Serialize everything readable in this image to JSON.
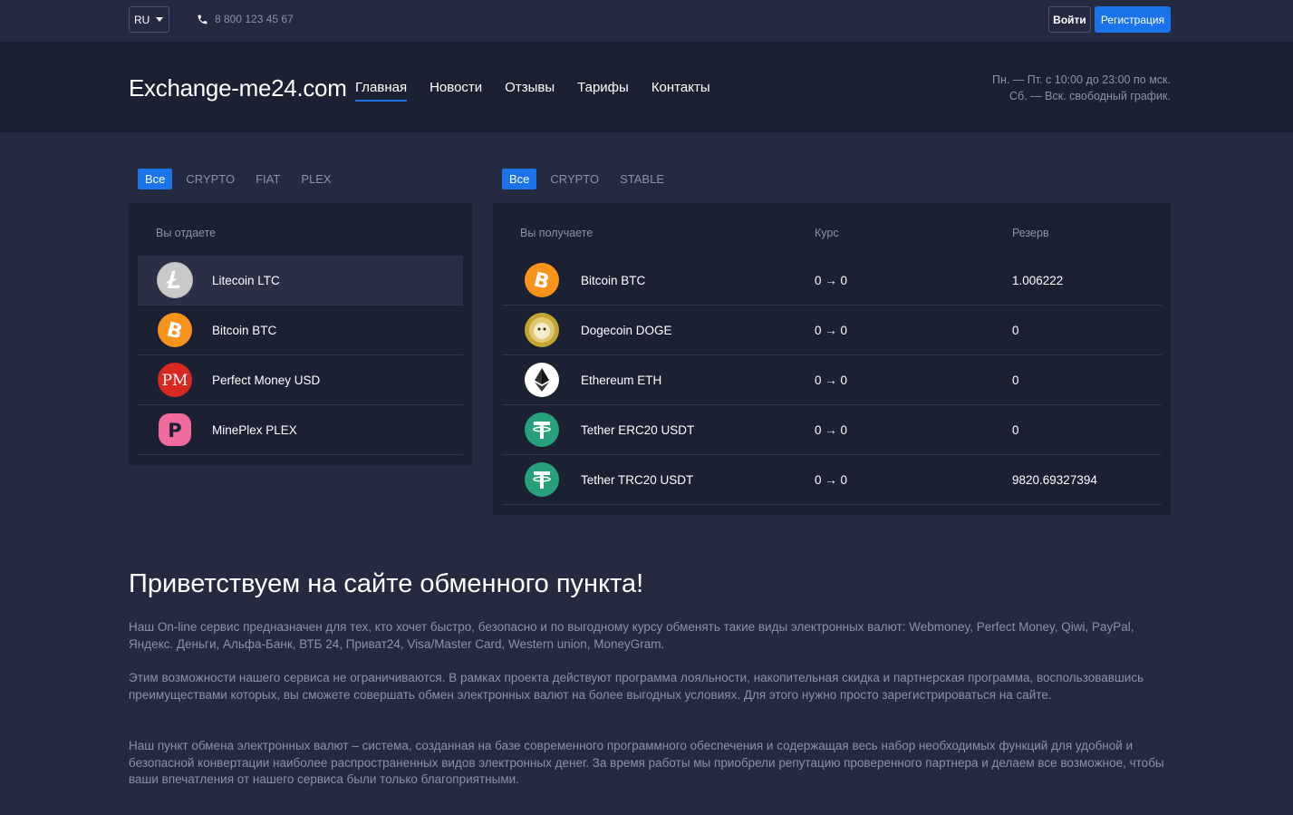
{
  "topbar": {
    "lang": "RU",
    "phone": "8 800 123 45 67",
    "login_label": "Войти",
    "register_label": "Регистрация"
  },
  "header": {
    "logo": "Exchange-me24.com",
    "nav": [
      {
        "label": "Главная",
        "active": true
      },
      {
        "label": "Новости"
      },
      {
        "label": "Отзывы"
      },
      {
        "label": "Тарифы"
      },
      {
        "label": "Контакты"
      }
    ],
    "hours_line1": "Пн. — Пт. с 10:00 до 23:00 по мск.",
    "hours_line2": "Сб. — Вск. свободный график."
  },
  "give": {
    "tabs": [
      "Все",
      "CRYPTO",
      "FIAT",
      "PLEX"
    ],
    "heading": "Вы отдаете",
    "items": [
      {
        "name": "Litecoin LTC",
        "icon": "litecoin-icon",
        "selected": true
      },
      {
        "name": "Bitcoin BTC",
        "icon": "bitcoin-icon"
      },
      {
        "name": "Perfect Money USD",
        "icon": "perfect-money-icon"
      },
      {
        "name": "MinePlex PLEX",
        "icon": "mineplex-icon"
      }
    ]
  },
  "receive": {
    "tabs": [
      "Все",
      "CRYPTO",
      "STABLE"
    ],
    "heading": "Вы получаете",
    "rate_heading": "Курс",
    "reserve_heading": "Резерв",
    "items": [
      {
        "name": "Bitcoin BTC",
        "icon": "bitcoin-icon",
        "rate": "0 → 0",
        "reserve": "1.006222"
      },
      {
        "name": "Dogecoin DOGE",
        "icon": "dogecoin-icon",
        "rate": "0 → 0",
        "reserve": "0"
      },
      {
        "name": "Ethereum ETH",
        "icon": "ethereum-icon",
        "rate": "0 → 0",
        "reserve": "0"
      },
      {
        "name": "Tether ERC20 USDT",
        "icon": "tether-icon",
        "rate": "0 → 0",
        "reserve": "0"
      },
      {
        "name": "Tether TRC20 USDT",
        "icon": "tether-icon",
        "rate": "0 → 0",
        "reserve": "9820.69327394"
      }
    ]
  },
  "welcome": {
    "title": "Приветствуем на сайте обменного пункта!",
    "p1": "Наш On-line сервис предназначен для тех, кто хочет быстро, безопасно и по выгодному курсу обменять такие виды электронных валют: Webmoney, Perfect Money, Qiwi, PayPal, Яндекс. Деньги, Альфа-Банк, ВТБ 24, Приват24, Visa/Master Card, Western union, MoneyGram.",
    "p2": "Этим возможности нашего сервиса не ограничиваются. В рамках проекта действуют программа лояльности, накопительная скидка и партнерская программа, воспользовавшись преимуществами которых, вы сможете совершать обмен электронных валют на более выгодных условиях. Для этого нужно просто зарегистрироваться на сайте.",
    "p3": "Наш пункт обмена электронных валют – система, созданная на базе современного программного обеспечения и содержащая весь набор необходимых функций для удобной и безопасной конвертации наиболее распространенных видов электронных денег. За время работы мы приобрели репутацию проверенного партнера и делаем все возможное, чтобы ваши впечатления от нашего сервиса были только благоприятными."
  },
  "colors": {
    "accent": "#1a73e8",
    "bg": "#252a40",
    "panel": "#1c2033",
    "muted": "#8b91a8"
  }
}
